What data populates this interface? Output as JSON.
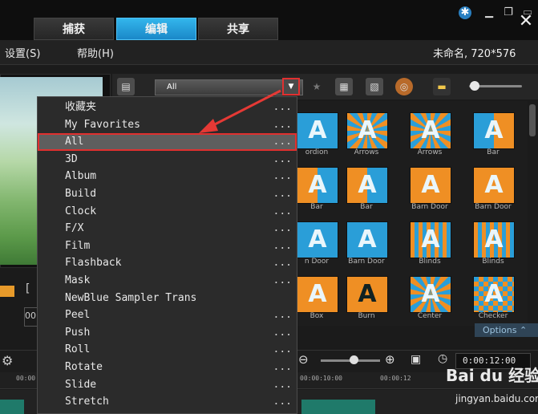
{
  "window": {
    "tabs": [
      {
        "label": "捕获",
        "active": false
      },
      {
        "label": "编辑",
        "active": true
      },
      {
        "label": "共享",
        "active": false
      }
    ],
    "close_glyph": "✕"
  },
  "menubar": {
    "items": [
      "设置(S)",
      "帮助(H)"
    ],
    "project_info": "未命名, 720*576"
  },
  "library": {
    "category_value": "All",
    "options_label": "Options"
  },
  "dropdown": {
    "selected_index": 2,
    "items": [
      {
        "label": "收藏夹",
        "dots": "..."
      },
      {
        "label": "My Favorites",
        "dots": "..."
      },
      {
        "label": "All",
        "dots": "..."
      },
      {
        "label": "3D",
        "dots": "..."
      },
      {
        "label": "Album",
        "dots": "..."
      },
      {
        "label": "Build",
        "dots": "..."
      },
      {
        "label": "Clock",
        "dots": "..."
      },
      {
        "label": "F/X",
        "dots": "..."
      },
      {
        "label": "Film",
        "dots": "..."
      },
      {
        "label": "Flashback",
        "dots": "..."
      },
      {
        "label": "Mask",
        "dots": "..."
      },
      {
        "label": "NewBlue Sampler Trans",
        "dots": ""
      },
      {
        "label": "Peel",
        "dots": "..."
      },
      {
        "label": "Push",
        "dots": "..."
      },
      {
        "label": "Roll",
        "dots": "..."
      },
      {
        "label": "Rotate",
        "dots": "..."
      },
      {
        "label": "Slide",
        "dots": "..."
      },
      {
        "label": "Stretch",
        "dots": "..."
      }
    ]
  },
  "transitions": {
    "rows": [
      [
        "ordion",
        "Arrows",
        "Arrows",
        "Bar"
      ],
      [
        "Bar",
        "Bar",
        "Barn Door",
        "Barn Door"
      ],
      [
        "n Door",
        "Barn Door",
        "Blinds",
        "Blinds"
      ],
      [
        "Box",
        "Burn",
        "Center",
        "Checker"
      ]
    ]
  },
  "timeline": {
    "timecode": "0:00:12:00",
    "ruler": [
      "00:00",
      "00:00:10:00",
      "00:00:12"
    ]
  },
  "watermark": {
    "main": "Bai du 经验",
    "sub": "jingyan.baidu.com"
  }
}
